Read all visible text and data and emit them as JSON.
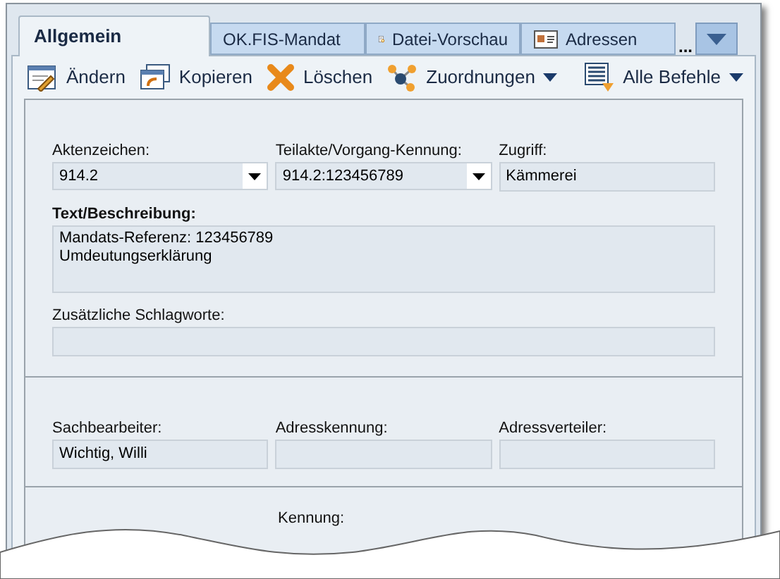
{
  "tabs": [
    {
      "label": "Allgemein",
      "selected": true
    },
    {
      "label": "OK.FIS-Mandat",
      "selected": false
    },
    {
      "label": "Datei-Vorschau",
      "selected": false
    },
    {
      "label": "Adressen",
      "selected": false
    }
  ],
  "tab_overflow": "...",
  "toolbar": [
    {
      "label": "Ändern",
      "dropdown": false
    },
    {
      "label": "Kopieren",
      "dropdown": false
    },
    {
      "label": "Löschen",
      "dropdown": false
    },
    {
      "label": "Zuordnungen",
      "dropdown": true
    },
    {
      "label": "Alle Befehle",
      "dropdown": true
    }
  ],
  "sections": [
    {
      "rows": [
        {
          "fields": [
            {
              "label": "Aktenzeichen:",
              "kind": "combo",
              "value": "914.2"
            },
            {
              "label": "Teilakte/Vorgang-Kennung:",
              "kind": "combo",
              "value": "914.2:123456789"
            },
            {
              "label": "Zugriff:",
              "kind": "text",
              "value": "Kämmerei"
            }
          ]
        },
        {
          "fields": [
            {
              "label": "Text/Beschreibung:",
              "kind": "textarea",
              "bold": true,
              "value": "Mandats-Referenz: 123456789\nUmdeutungserklärung"
            }
          ]
        },
        {
          "fields": [
            {
              "label": "Zusätzliche Schlagworte:",
              "kind": "text",
              "bold": false
            }
          ]
        }
      ]
    },
    {
      "rows": [
        {
          "fields": [
            {
              "label": "Sachbearbeiter:",
              "kind": "text",
              "value": "Wichtig, Willi"
            },
            {
              "label": "Adresskennung:",
              "kind": "text"
            },
            {
              "label": "Adressverteiler:",
              "kind": "text"
            }
          ]
        }
      ]
    },
    {
      "rows": [
        {
          "fields": [
            {
              "kind": "spacer"
            },
            {
              "label": "Kennung:",
              "kind": "label"
            }
          ]
        }
      ]
    }
  ]
}
